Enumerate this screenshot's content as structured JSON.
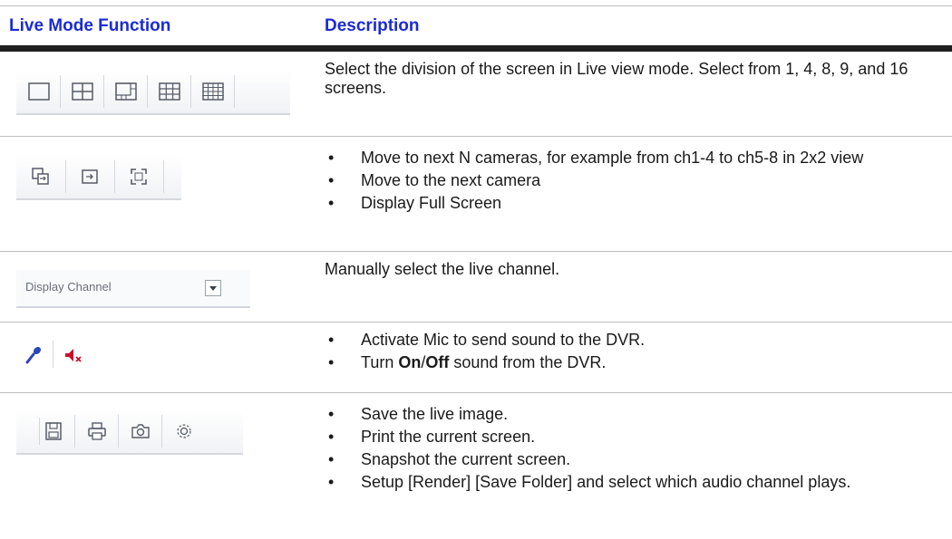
{
  "header": {
    "col_function": "Live Mode Function",
    "col_description": "Description"
  },
  "rows": [
    {
      "icons": [
        "single-screen-icon",
        "quad-screen-icon",
        "eight-screen-icon",
        "nine-screen-icon",
        "sixteen-screen-icon"
      ],
      "description": "Select the division of the screen in Live view mode. Select from 1, 4, 8, 9, and 16 screens."
    },
    {
      "icons": [
        "next-group-icon",
        "next-camera-icon",
        "full-screen-icon"
      ],
      "bullets": [
        "Move to next N cameras, for example from ch1-4 to ch5-8 in 2x2 view",
        "Move to the next camera",
        "Display Full Screen"
      ]
    },
    {
      "dropdown_label": "Display Channel",
      "icons": [
        "dropdown-arrow-icon"
      ],
      "description": "Manually select the live channel."
    },
    {
      "icons": [
        "microphone-icon",
        "speaker-mute-icon"
      ],
      "bullets": [
        {
          "before": "Activate Mic to send sound to the DVR.",
          "bold1": "",
          "mid": "",
          "bold2": "",
          "after": ""
        },
        {
          "before": "Turn ",
          "bold1": "On",
          "mid": "/",
          "bold2": "Off",
          "after": " sound from the DVR."
        }
      ]
    },
    {
      "icons": [
        "save-icon",
        "print-icon",
        "snapshot-icon",
        "setup-icon"
      ],
      "bullets": [
        "Save the live image.",
        "Print the current screen.",
        "Snapshot the current screen.",
        "Setup [Render] [Save Folder] and select which audio channel plays."
      ]
    }
  ],
  "bullet_symbol": "•",
  "colors": {
    "header_text": "#1a2bd6",
    "icon_stroke": "#555a66",
    "mic_color": "#2b46b8",
    "mute_color": "#c8102e"
  }
}
